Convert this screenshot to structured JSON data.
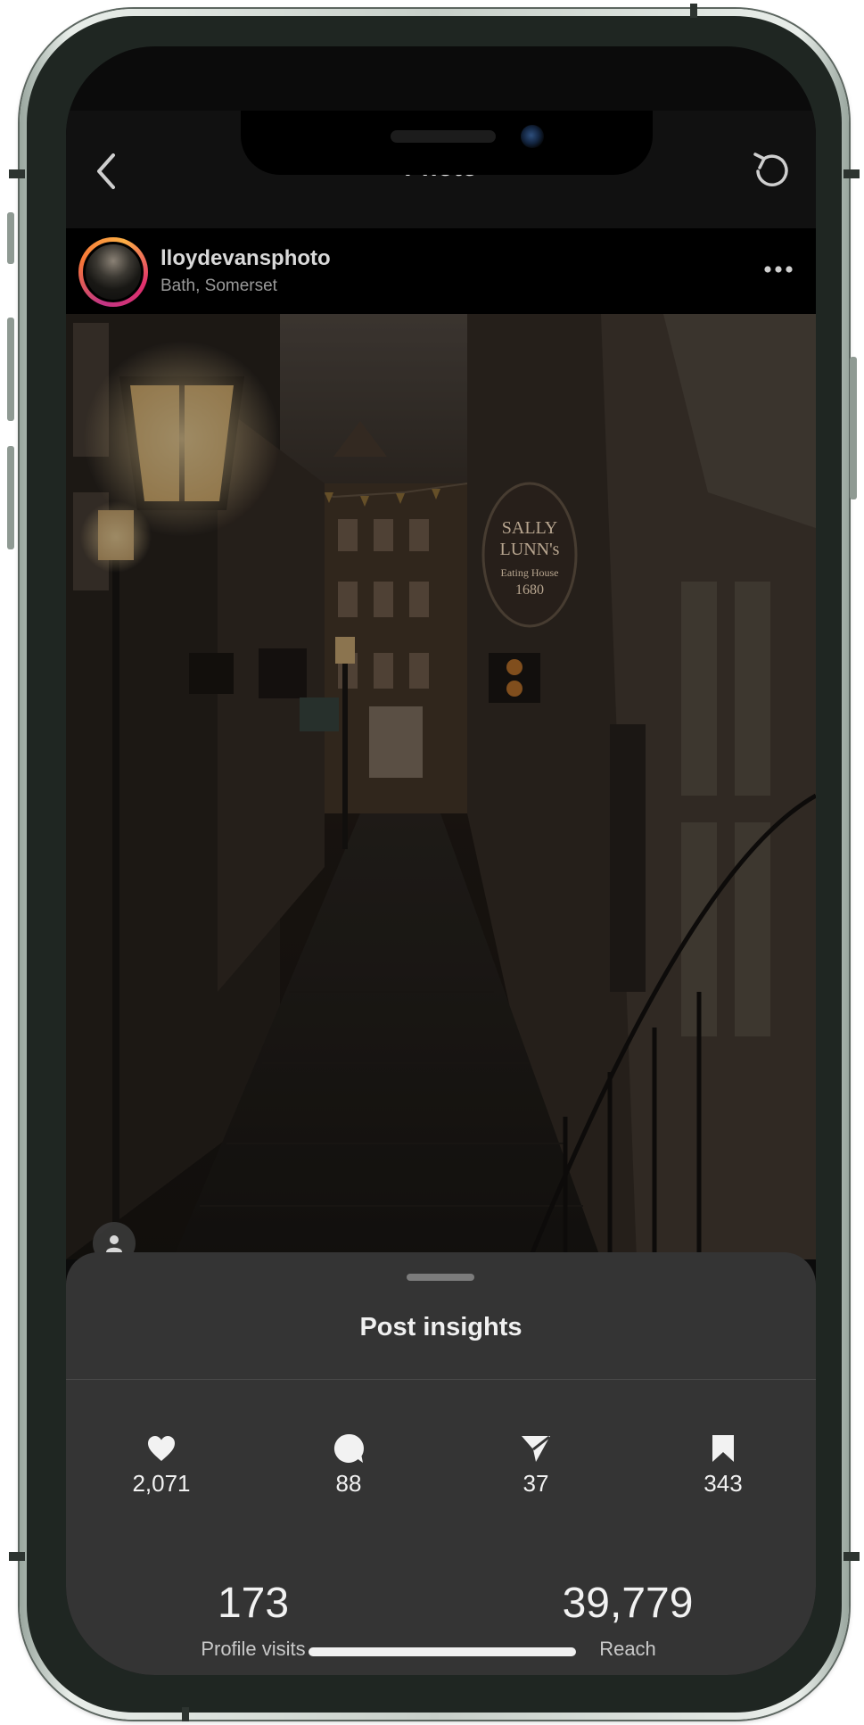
{
  "header": {
    "title": "Photo",
    "back_icon": "chevron-left-icon",
    "refresh_icon": "refresh-icon"
  },
  "post": {
    "username": "lloydevansphoto",
    "location": "Bath, Somerset",
    "more_icon": "more-horizontal-icon",
    "photo_sign_lines": [
      "SALLY",
      "LUNN's",
      "Eating House",
      "1680"
    ]
  },
  "insights": {
    "title": "Post insights",
    "metrics": [
      {
        "icon": "heart-icon",
        "value": "2,071"
      },
      {
        "icon": "comment-icon",
        "value": "88"
      },
      {
        "icon": "share-icon",
        "value": "37"
      },
      {
        "icon": "bookmark-icon",
        "value": "343"
      }
    ],
    "stats": [
      {
        "value": "173",
        "label": "Profile visits"
      },
      {
        "value": "39,779",
        "label": "Reach"
      }
    ]
  },
  "colors": {
    "sheet_background": "#343434",
    "text_primary": "#f2f2f2",
    "story_ring": "#e1306c"
  }
}
